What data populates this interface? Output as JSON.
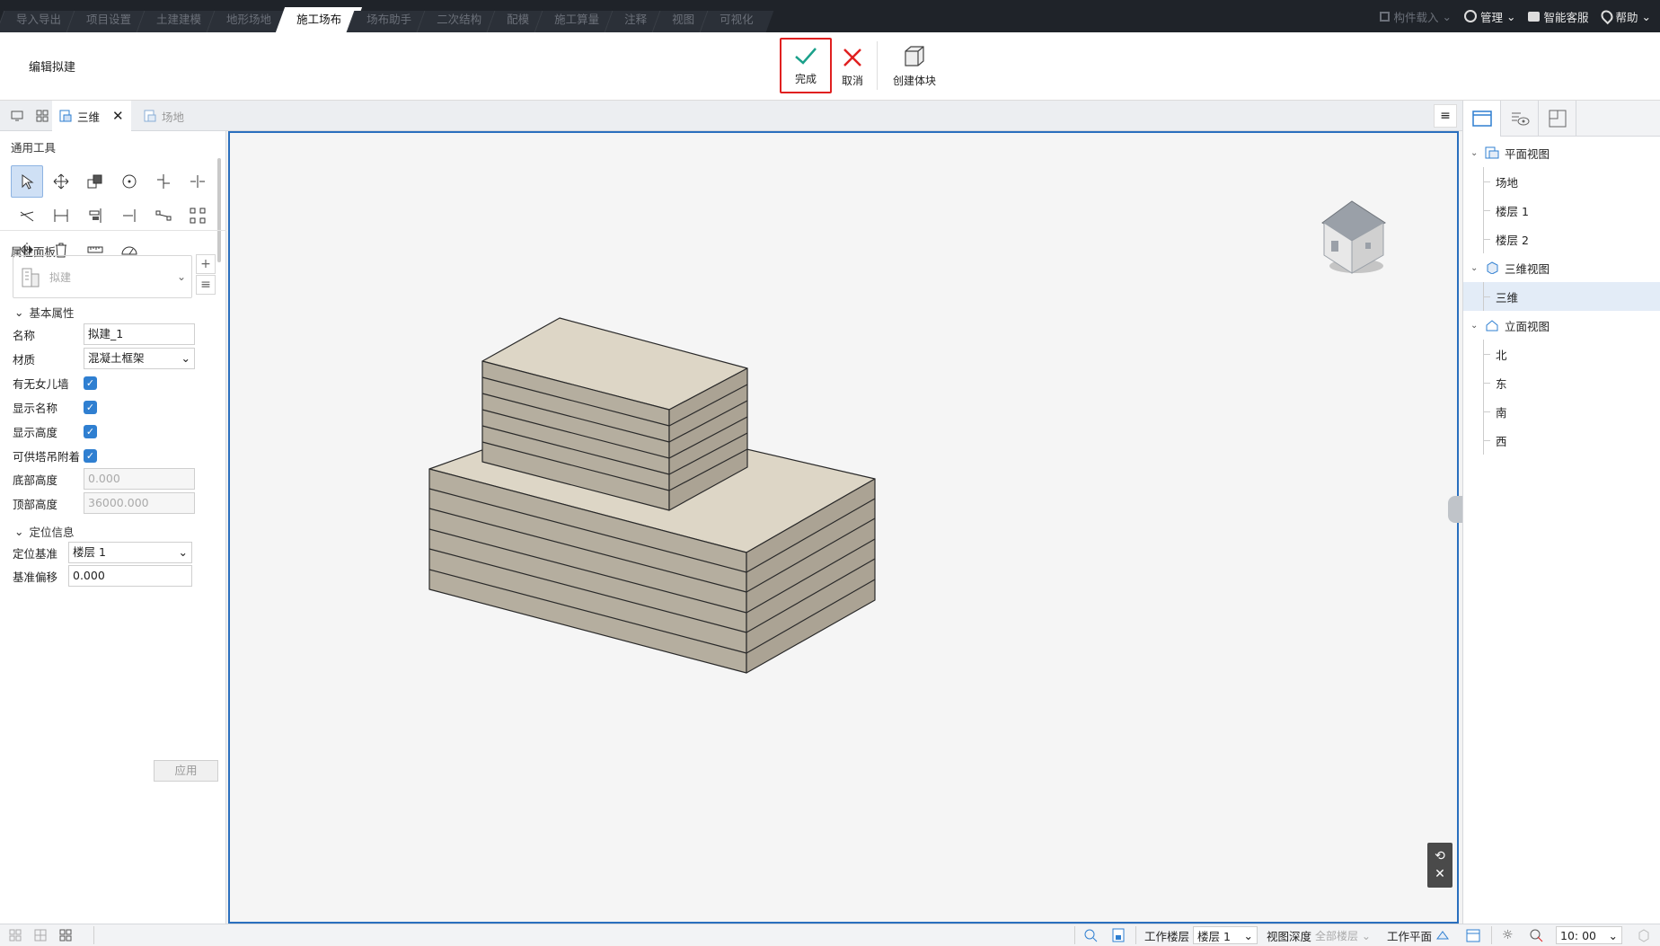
{
  "menu_tabs": [
    "导入导出",
    "项目设置",
    "土建建模",
    "地形场地",
    "施工场布",
    "场布助手",
    "二次结构",
    "配模",
    "施工算量",
    "注释",
    "视图",
    "可视化"
  ],
  "active_menu_index": 4,
  "top_right": {
    "component_load": "构件载入",
    "manage": "管理",
    "smart_service": "智能客服",
    "help": "帮助"
  },
  "ribbon": {
    "title": "编辑拟建",
    "done": "完成",
    "cancel": "取消",
    "create_block": "创建体块"
  },
  "view_tabs": {
    "tab_3d": "三维",
    "tab_site": "场地"
  },
  "left_panel": {
    "tools_title": "通用工具",
    "props_title": "属性面板",
    "type_placeholder": "拟建",
    "basic_group": "基本属性",
    "props": {
      "name_label": "名称",
      "name_value": "拟建_1",
      "material_label": "材质",
      "material_value": "混凝土框架",
      "parapet_label": "有无女儿墙",
      "parapet_checked": true,
      "show_name_label": "显示名称",
      "show_name_checked": true,
      "show_height_label": "显示高度",
      "show_height_checked": true,
      "tower_label": "可供塔吊附着",
      "tower_checked": true,
      "bottom_label": "底部高度",
      "bottom_value": "0.000",
      "top_label": "顶部高度",
      "top_value": "36000.000"
    },
    "loc_group": "定位信息",
    "loc": {
      "base_label": "定位基准",
      "base_value": "楼层 1",
      "offset_label": "基准偏移",
      "offset_value": "0.000"
    },
    "apply": "应用"
  },
  "tree": {
    "plan": "平面视图",
    "plan_items": [
      "场地",
      "楼层 1",
      "楼层 2"
    ],
    "three_d": "三维视图",
    "three_d_items": [
      "三维"
    ],
    "elev": "立面视图",
    "elev_items": [
      "北",
      "东",
      "南",
      "西"
    ]
  },
  "status": {
    "work_floor_label": "工作楼层",
    "work_floor_value": "楼层 1",
    "view_depth_label": "视图深度",
    "view_depth_value": "全部楼层",
    "work_plane_label": "工作平面",
    "time_value": "10: 00"
  },
  "colors": {
    "accent": "#2f7fd1",
    "done_check": "#1aa08a",
    "cancel_x": "#e02020",
    "building_top": "#ddd6c6",
    "building_side": "#b5ae9f",
    "building_edge": "#2a2a2a"
  }
}
